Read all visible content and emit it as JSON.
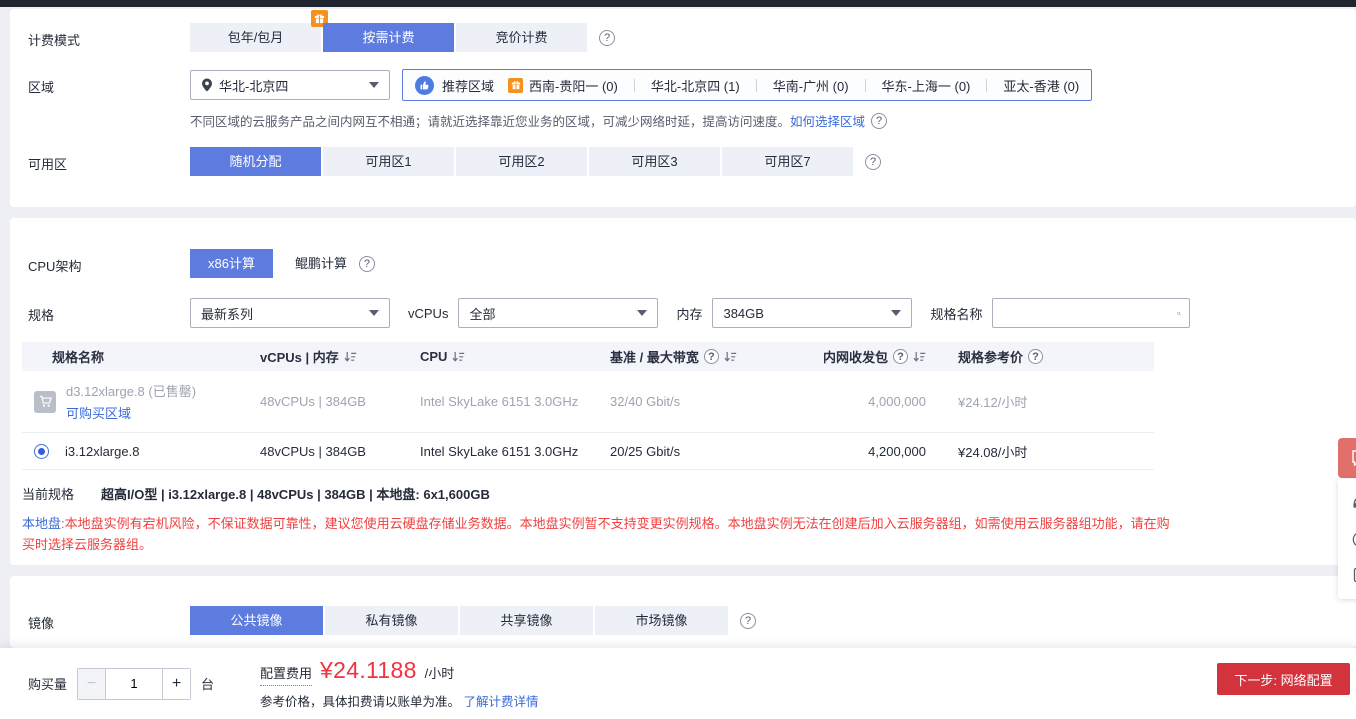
{
  "billing": {
    "label": "计费模式",
    "tab_prepaid": "包年/包月",
    "tab_ondemand": "按需计费",
    "tab_spot": "竞价计费"
  },
  "region": {
    "label": "区域",
    "selected": "华北-北京四",
    "recommend_label": "推荐区域",
    "items": [
      {
        "name": "西南-贵阳一 (0)"
      },
      {
        "name": "华北-北京四 (1)"
      },
      {
        "name": "华南-广州 (0)"
      },
      {
        "name": "华东-上海一 (0)"
      },
      {
        "name": "亚太-香港 (0)"
      }
    ],
    "hint": "不同区域的云服务产品之间内网互不相通；请就近选择靠近您业务的区域，可减少网络时延，提高访问速度。",
    "hint_link": "如何选择区域"
  },
  "az": {
    "label": "可用区",
    "tabs": [
      "随机分配",
      "可用区1",
      "可用区2",
      "可用区3",
      "可用区7"
    ]
  },
  "cpu": {
    "label": "CPU架构",
    "tab_x86": "x86计算",
    "tab_kunpeng": "鲲鹏计算"
  },
  "spec": {
    "label": "规格",
    "series": "最新系列",
    "vcpus_label": "vCPUs",
    "vcpus": "全部",
    "mem_label": "内存",
    "mem": "384GB",
    "name_label": "规格名称"
  },
  "table": {
    "headers": {
      "name": "规格名称",
      "vcpu_mem": "vCPUs | 内存",
      "cpu": "CPU",
      "bw": "基准 / 最大带宽",
      "pps": "内网收发包",
      "price": "规格参考价"
    },
    "rows": [
      {
        "name": "d3.12xlarge.8 (已售罄)",
        "link": "可购买区域",
        "vcpu_mem": "48vCPUs | 384GB",
        "cpu": "Intel SkyLake 6151 3.0GHz",
        "bw": "32/40 Gbit/s",
        "pps": "4,000,000",
        "price": "¥24.12/小时"
      },
      {
        "name": "i3.12xlarge.8",
        "vcpu_mem": "48vCPUs | 384GB",
        "cpu": "Intel SkyLake 6151 3.0GHz",
        "bw": "20/25 Gbit/s",
        "pps": "4,200,000",
        "price": "¥24.08/小时"
      }
    ]
  },
  "current_spec": {
    "label": "当前规格",
    "value": "超高I/O型 | i3.12xlarge.8 | 48vCPUs | 384GB | 本地盘: 6x1,600GB"
  },
  "warning": {
    "prefix": "本地盘",
    "text": ":本地盘实例有宕机风险，不保证数据可靠性，建议您使用云硬盘存储业务数据。本地盘实例暂不支持变更实例规格。本地盘实例无法在创建后加入云服务器组，如需使用云服务器组功能，请在购买时选择云服务器组。"
  },
  "image": {
    "label": "镜像",
    "tabs": [
      "公共镜像",
      "私有镜像",
      "共享镜像",
      "市场镜像"
    ]
  },
  "footer": {
    "qty_label": "购买量",
    "qty": "1",
    "unit": "台",
    "fee_label": "配置费用",
    "price": "¥24.1188",
    "per": "/小时",
    "note": "参考价格，具体扣费请以账单为准。",
    "billing_link": "了解计费详情",
    "next_button": "下一步: 网络配置"
  },
  "colors": {
    "accent": "#5e7ce0",
    "price_red": "#ee3340",
    "button_red": "#d2333d",
    "warning_red": "#ef4040",
    "link_blue": "#3a6bd8"
  }
}
